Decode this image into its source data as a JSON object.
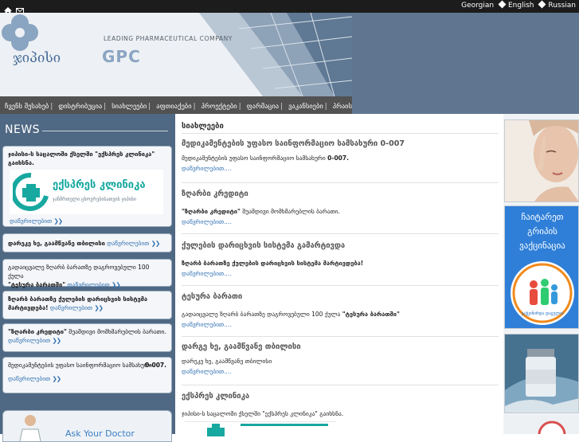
{
  "top_bar": {
    "languages": [
      "Georgian",
      "English",
      "Russian"
    ]
  },
  "header": {
    "tagline": "LEADING PHARMACEUTICAL COMPANY",
    "logo_georgian": "ჯიპისი",
    "logo_gpc": "GPC"
  },
  "nav": {
    "items": [
      "ჩვენს შესახებ",
      "დისტრიბუცია",
      "სიახლეები",
      "აფთიაქები",
      "პროექტები",
      "ფარმაცია",
      "ვაკანსიები",
      "პრაისი"
    ]
  },
  "sidebar": {
    "news_title": "NEWS",
    "more_label": "დაწვრილებით",
    "boxes": [
      {
        "text": "ჯიპისი-ს საცალოში ქსელში \"ექსპრეს კლინიკა\" გაიხსნა."
      },
      {
        "text": "დარეკე ხე, გაამწვანე თბილისი"
      },
      {
        "text": "გადაიცვალე  ზღარბ ბარათზე დაგროვებული 100 ქულა",
        "bold": "\"ტესურა ბარათში\""
      },
      {
        "text": "ზღარბ ბარათზე ქულების დარიცხვის სისტემა მარტივდება!"
      },
      {
        "bold": "\"ზღარბი კრედიტი\"",
        "text": " შუამდივი მომხმარებლის ბარათი."
      },
      {
        "text": "მედიკამენტების უფასო საინფორმაციო სამსახური",
        "suffix": "0-007."
      }
    ],
    "clinic_logo_text": "ექსპრეს კლინიკა",
    "clinic_logo_sub": "ჯანმრთელი ცხოვრებისათვის ჯიპისი",
    "doctor_text": "Ask Your Doctor"
  },
  "main": {
    "title": "სიახლეები",
    "more_label": "დაწვრილებით....",
    "items": [
      {
        "title": "მედიკამენტების უფასო საინფორმაციო სამსახური 0-007",
        "desc": "მედიკამენტების უფასო საინფორმაციო სამსახური ",
        "desc_bold": "0-007."
      },
      {
        "title": "ზღარბი კრედიტი",
        "desc_bold": "\"ზღარბი კრედიტი\"",
        "desc": " შუამდივი მომხმარებლის ბარათი."
      },
      {
        "title": "ქულების დარიცხვის სისტემა გამარტივდა",
        "desc_bold": "ზღარბ ბარათზე ქულების დარიცხვის სისტემა მარტივდება!"
      },
      {
        "title": "ტესურა ბარათი",
        "desc": "გადაიცვალე  ზღარბ ბარათზე დაგროვებული 100 ქულა ",
        "desc_bold": "\"ტესურა ბარათში\""
      },
      {
        "title": "დარგე ხე, გაამწვანე თბილისი",
        "desc": "დარეკე ხე, გაამწვანე თბილისი"
      },
      {
        "title": "ექსპრეს კლინიკა",
        "desc": "ჯიპისი-ს საცალოში ქსელში \"ექსპრეს კლინიკა\" გაიხსნა."
      }
    ]
  },
  "right_ads": {
    "flu_lines": [
      "ჩაიტარეთ",
      "გრიპის",
      "ვაქცინაცია"
    ],
    "flu_circle": "ვაქცინირდა დაცულია"
  },
  "colors": {
    "sidebar_bg": "#4f6883",
    "link": "#2f6fb0",
    "nav_bg": "#525252"
  }
}
